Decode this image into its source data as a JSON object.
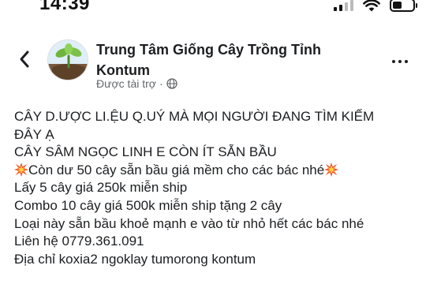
{
  "status_bar": {
    "time": "14:39",
    "icons": [
      "cellular-signal-icon",
      "wifi-icon",
      "battery-icon"
    ]
  },
  "header": {
    "back_icon": "chevron-left-icon",
    "page_name": "Trung Tâm Giống Cây Trồng Tỉnh Kontum",
    "sponsored_label": "Được tài trợ",
    "separator": "·",
    "privacy_icon": "globe-icon",
    "more_icon": "more-horizontal-icon"
  },
  "post": {
    "lines": [
      "CÂY D.ƯỢC LI.ỆU Q.UÝ MÀ MỌI NGƯỜI ĐANG TÌM KIẾM",
      "ĐÂY Ạ",
      "CÂY SÂM NGỌC LINH E CÒN ÍT SẴN BẦU",
      "Còn dư  50 cây sẵn bầu giá mềm cho các bác nhé",
      "Lấy 5 cây giá 250k miễn ship",
      "Combo 10 cây giá 500k miễn ship tặng 2 cây",
      "Loại này sẵn bầu khoẻ mạnh e vào từ nhỏ hết các bác nhé",
      "Liên hệ 0779.361.091",
      "Địa chỉ koxia2 ngoklay tumorong kontum"
    ],
    "emoji_icon": "collision-burst-emoji"
  },
  "colors": {
    "text_primary": "#1c1e21",
    "text_secondary": "#65676b",
    "background": "#ffffff"
  }
}
